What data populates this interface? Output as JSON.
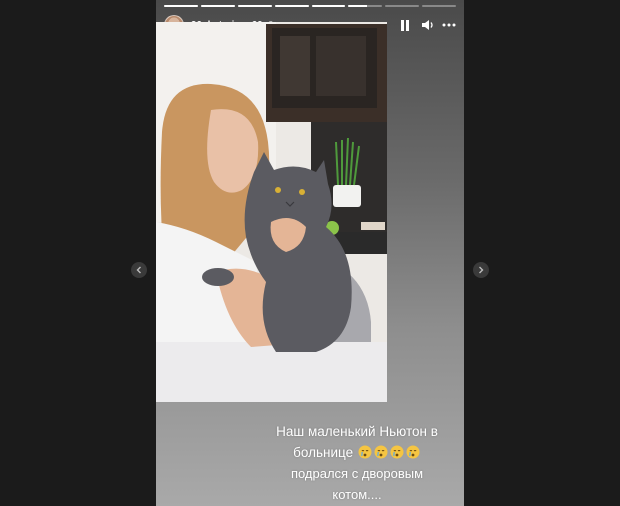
{
  "story": {
    "username": "90_katerina_60",
    "time_ago": "6 ч",
    "segments_total": 8,
    "active_segment": 6,
    "active_progress": 0.55
  },
  "caption": {
    "line1": "Наш маленький Ньютон в",
    "line2": "больнице",
    "line3": "подрался с дворовым",
    "line4": "котом....",
    "emoji_count": 4,
    "emoji_name": "crying-face-emoji"
  },
  "icons": {
    "pause": "pause-icon",
    "sound": "speaker-icon",
    "more": "more-icon",
    "prev": "chevron-left-icon",
    "next": "chevron-right-icon"
  },
  "colors": {
    "background": "#1b1b1b",
    "text": "#ffffff",
    "emoji": "#f5c542"
  }
}
